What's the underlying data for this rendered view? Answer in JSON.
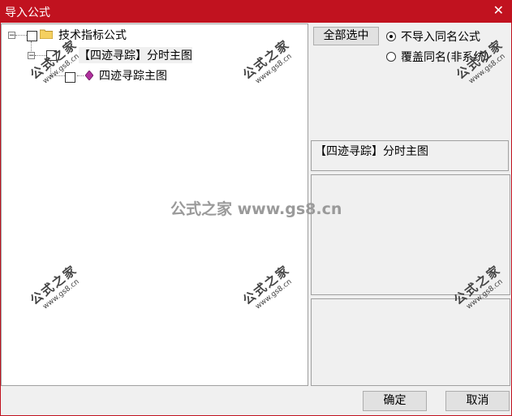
{
  "window": {
    "title": "导入公式",
    "close_glyph": "✕"
  },
  "tree": {
    "root": {
      "label": "技术指标公式",
      "expander": "⊟",
      "icon": "folder-icon"
    },
    "group": {
      "label": "【四迹寻踪】分时主图",
      "expander": "⊟"
    },
    "leaf": {
      "label": "四迹寻踪主图",
      "icon": "gem-icon"
    }
  },
  "options": {
    "select_all_label": "全部选中",
    "radio_skip_label": "不导入同名公式",
    "radio_overwrite_label": "覆盖同名(非系统)",
    "selected": "skip"
  },
  "info": {
    "formula_name": "【四迹寻踪】分时主图"
  },
  "buttons": {
    "ok_label": "确定",
    "cancel_label": "取消"
  },
  "watermark": {
    "brand": "公式之家",
    "url": "www.gs8.cn",
    "center_text": "公式之家 www.gs8.cn"
  },
  "colors": {
    "titlebar": "#c1121f",
    "folder": "#f5d060",
    "gem": "#b0309e"
  }
}
